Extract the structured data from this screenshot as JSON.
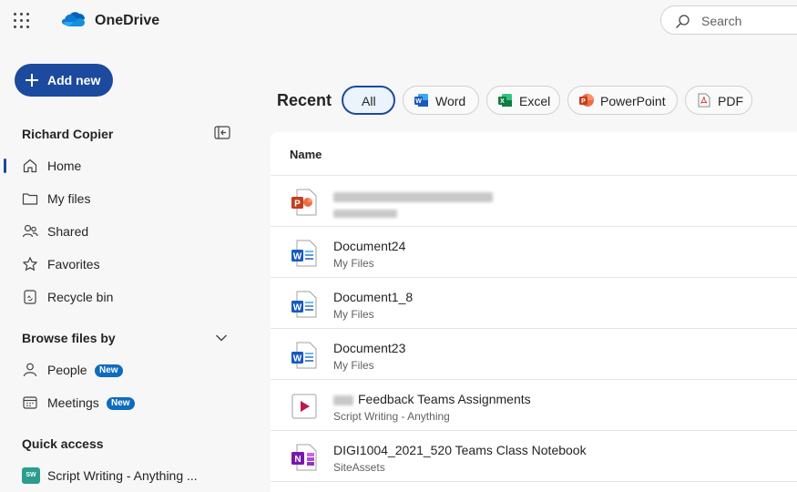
{
  "header": {
    "brand": "OneDrive",
    "search_placeholder": "Search"
  },
  "add_new": {
    "label": "Add new"
  },
  "sidebar": {
    "user_name": "Richard Copier",
    "items": [
      {
        "label": "Home",
        "icon": "home-icon",
        "active": true
      },
      {
        "label": "My files",
        "icon": "folder-icon"
      },
      {
        "label": "Shared",
        "icon": "people-icon"
      },
      {
        "label": "Favorites",
        "icon": "star-icon"
      },
      {
        "label": "Recycle bin",
        "icon": "recycle-bin-icon"
      }
    ],
    "browse_title": "Browse files by",
    "browse_items": [
      {
        "label": "People",
        "badge": "New",
        "icon": "person-icon"
      },
      {
        "label": "Meetings",
        "badge": "New",
        "icon": "calendar-icon"
      }
    ],
    "quick_access_title": "Quick access",
    "quick_access_items": [
      {
        "label": "Script Writing - Anything ...",
        "initials": "SW",
        "color": "#2a9d8f"
      }
    ]
  },
  "filters": {
    "title": "Recent",
    "pills": [
      {
        "label": "All",
        "selected": true
      },
      {
        "label": "Word",
        "icon": "word-icon"
      },
      {
        "label": "Excel",
        "icon": "excel-icon"
      },
      {
        "label": "PowerPoint",
        "icon": "powerpoint-icon"
      },
      {
        "label": "PDF",
        "icon": "pdf-icon"
      }
    ]
  },
  "file_list": {
    "column_name": "Name",
    "rows": [
      {
        "name": "",
        "location": "",
        "type": "powerpoint",
        "obscured": true
      },
      {
        "name": "Document24",
        "location": "My Files",
        "type": "word"
      },
      {
        "name": "Document1_8",
        "location": "My Files",
        "type": "word"
      },
      {
        "name": "Document23",
        "location": "My Files",
        "type": "word"
      },
      {
        "name": "Feedback Teams Assignments",
        "location": "Script Writing - Anything",
        "type": "stream",
        "name_prefix_obscured": true
      },
      {
        "name": "DIGI1004_2021_520 Teams Class Notebook",
        "location": "SiteAssets",
        "type": "onenote"
      }
    ]
  },
  "colors": {
    "accent": "#1b4a9e",
    "badge": "#0f6cbd",
    "word": "#185abd",
    "excel": "#107c41",
    "powerpoint": "#c43e1c",
    "onenote": "#7719aa"
  }
}
